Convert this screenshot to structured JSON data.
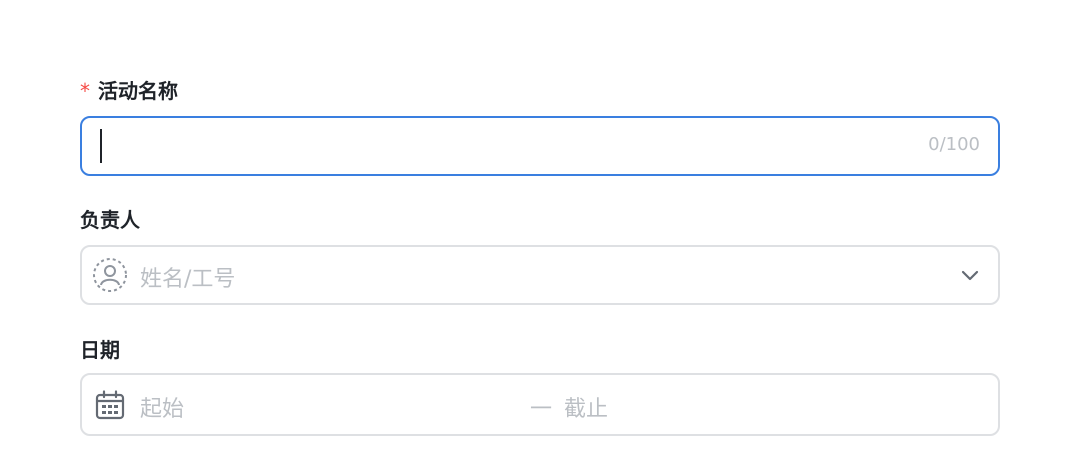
{
  "form": {
    "activity_name": {
      "required_mark": "*",
      "label": "活动名称",
      "value": "",
      "placeholder": "",
      "counter": "0/100"
    },
    "owner": {
      "label": "负责人",
      "placeholder": "姓名/工号",
      "leading_icon": "user-avatar-icon",
      "trailing_icon": "chevron-down-icon"
    },
    "date": {
      "label": "日期",
      "start_placeholder": "起始",
      "separator": "一",
      "end_placeholder": "截止",
      "leading_icon": "calendar-icon"
    }
  },
  "colors": {
    "focus_border": "#3a7fe0",
    "border": "#dee0e3",
    "required": "#f54a45",
    "placeholder": "#bbbfc4",
    "label_text": "#1f2329"
  }
}
